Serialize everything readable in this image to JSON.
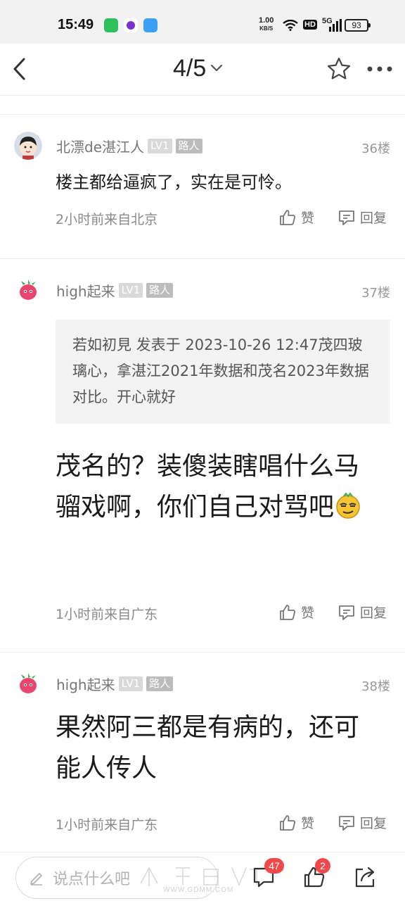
{
  "status_bar": {
    "time": "15:49",
    "net_speed_value": "1.00",
    "net_speed_unit": "KB/S",
    "hd_label": "HD",
    "network_label": "5G",
    "battery": "93"
  },
  "header": {
    "page_indicator": "4/5"
  },
  "posts": [
    {
      "user": "北漂de湛江人",
      "level": "LV1",
      "role": "路人",
      "floor": "36楼",
      "content": "楼主都给逼疯了，实在是可怜。",
      "meta": "2小时前来自北京",
      "like_label": "赞",
      "reply_label": "回复"
    },
    {
      "user": "high起来",
      "level": "LV1",
      "role": "路人",
      "floor": "37楼",
      "quote": "若如初見 发表于 2023-10-26 12:47茂四玻璃心，拿湛江2021年数据和茂名2023年数据对比。开心就好",
      "content": "茂名的？装傻装瞎唱什么马骝戏啊，你们自己对骂吧",
      "meta": "1小时前来自广东",
      "like_label": "赞",
      "reply_label": "回复"
    },
    {
      "user": "high起来",
      "level": "LV1",
      "role": "路人",
      "floor": "38楼",
      "content": "果然阿三都是有病的，还可能人传人",
      "meta": "1小时前来自广东",
      "like_label": "赞",
      "reply_label": "回复"
    }
  ],
  "bottom_bar": {
    "comment_placeholder": "说点什么吧",
    "comment_count": "47",
    "like_count": "2",
    "watermark": "WWW.GDMM.COM"
  },
  "colors": {
    "badge_red": "#f0494c",
    "meta_gray": "#8a8a8a"
  }
}
